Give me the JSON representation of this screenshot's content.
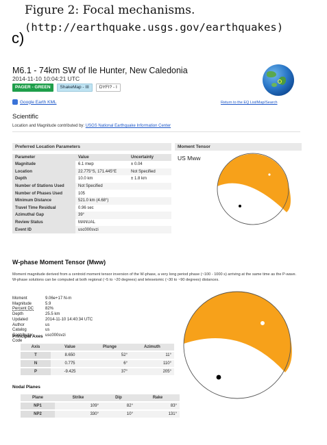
{
  "figure": {
    "caption": "Figure 2: Focal mechanisms.",
    "url": "(http://earthquake.usgs.gov/earthquakes)",
    "letter": "c)"
  },
  "event": {
    "title": "M6.1 - 74km SW of Ile Hunter, New Caledonia",
    "time": "2014-11-10 10:04:21 UTC",
    "badges": {
      "pager": "PAGER - GREEN",
      "shakemap": "ShakeMap - III",
      "dyfi": "DYFI? - I"
    },
    "google_earth": "Google Earth KML",
    "return_link": "Return to the EQ List/Map/Search"
  },
  "scientific": {
    "title": "Scientific",
    "contrib_prefix": "Location and Magnitude contributed by: ",
    "contrib_link": "USGS National Earthquake Information Center"
  },
  "location_panel": {
    "title": "Preferred Location Parameters",
    "headers": [
      "Parameter",
      "Value",
      "Uncertainty"
    ],
    "rows": [
      {
        "label": "Magnitude",
        "value": "6.1 mwp",
        "unc": "± 0.04"
      },
      {
        "label": "Location",
        "value": "22.775°S, 171.445°E",
        "unc": "Not Specified"
      },
      {
        "label": "Depth",
        "value": "10.0 km",
        "unc": "± 1.8 km"
      },
      {
        "label": "Number of Stations Used",
        "value": "Not Specified",
        "unc": ""
      },
      {
        "label": "Number of Phases Used",
        "value": "105",
        "unc": ""
      },
      {
        "label": "Minimum Distance",
        "value": "521.0 km (4.68°)",
        "unc": ""
      },
      {
        "label": "Travel Time Residual",
        "value": "0.96 sec",
        "unc": ""
      },
      {
        "label": "Azimuthal Gap",
        "value": "39°",
        "unc": ""
      },
      {
        "label": "Review Status",
        "value": "MANUAL",
        "unc": ""
      },
      {
        "label": "Event ID",
        "value": "usc000svzi",
        "unc": ""
      }
    ]
  },
  "moment_tensor": {
    "title": "Moment Tensor",
    "label": "US Mww",
    "fill_color": "#f7a11a"
  },
  "wphase": {
    "title": "W-phase Moment Tensor (Mww)",
    "description": "Moment magnitude derived from a centroid moment tensor inversion of the W-phase, a very long period phase (~100 - 1000 s) arriving at the same time as the P-wave. W-phase solutions can be computed at both regional (~5 to ~20 degrees) and teleseismic (~30 to ~90 degrees) distances.",
    "details": [
      {
        "k": "Moment",
        "v": "9.06e+17 N-m"
      },
      {
        "k": "Magnitude",
        "v": "5.9"
      },
      {
        "k": "Percent DC",
        "v": "82%"
      },
      {
        "k": "Depth",
        "v": "25.5 km"
      },
      {
        "k": "Updated",
        "v": "2014-11-10 14:40:34 UTC"
      },
      {
        "k": "Author",
        "v": "us"
      },
      {
        "k": "Catalog",
        "v": "us"
      },
      {
        "k": "Contributor",
        "v": "usc000svzi"
      },
      {
        "k": "Code",
        "v": ""
      }
    ]
  },
  "principal_axes": {
    "title": "Principal Axes",
    "headers": [
      "Axis",
      "Value",
      "Plunge",
      "Azimuth"
    ],
    "rows": [
      {
        "axis": "T",
        "value": "8.650",
        "plunge": "52°",
        "azimuth": "11°"
      },
      {
        "axis": "N",
        "value": "0.775",
        "plunge": "6°",
        "azimuth": "110°"
      },
      {
        "axis": "P",
        "value": "-9.425",
        "plunge": "37°",
        "azimuth": "205°"
      }
    ]
  },
  "nodal_planes": {
    "title": "Nodal Planes",
    "headers": [
      "Plane",
      "Strike",
      "Dip",
      "Rake"
    ],
    "rows": [
      {
        "plane": "NP1",
        "strike": "109°",
        "dip": "82°",
        "rake": "83°"
      },
      {
        "plane": "NP2",
        "strike": "330°",
        "dip": "10°",
        "rake": "131°"
      }
    ]
  }
}
